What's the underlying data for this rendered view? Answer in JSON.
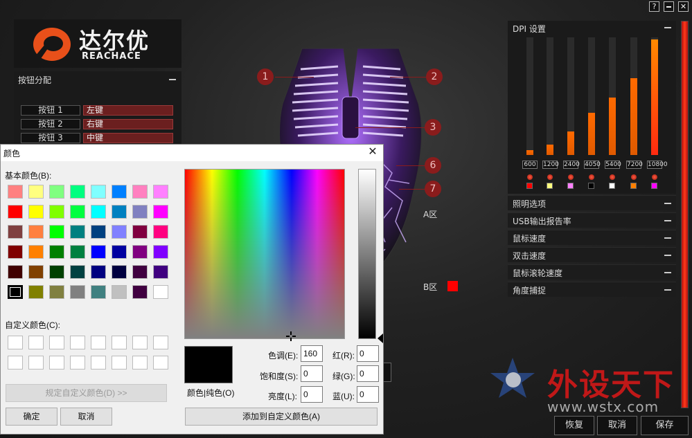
{
  "window": {
    "help_label": "?",
    "minimize_label": "",
    "close_label": "✕"
  },
  "logo": {
    "cn": "达尔优",
    "en": "REACHACE"
  },
  "buttons_panel": {
    "title": "按钮分配",
    "rows": [
      {
        "button": "按钮 1",
        "value": "左键"
      },
      {
        "button": "按钮 2",
        "value": "右键"
      },
      {
        "button": "按钮 3",
        "value": "中键"
      }
    ]
  },
  "mouse": {
    "callouts": [
      "1",
      "2",
      "3",
      "6",
      "7"
    ],
    "zones": [
      {
        "label": "A区"
      },
      {
        "label": "B区",
        "color": "#ff0000"
      }
    ]
  },
  "dpi": {
    "title": "DPI 设置",
    "levels": [
      {
        "value": "600",
        "level": 0.04,
        "color": "#ff0000"
      },
      {
        "value": "1200",
        "level": 0.09,
        "color": "#ffff80"
      },
      {
        "value": "2400",
        "level": 0.2,
        "color": "#ff80ff"
      },
      {
        "value": "4050",
        "level": 0.36,
        "color": "#000000"
      },
      {
        "value": "5400",
        "level": 0.49,
        "color": "#ffffff"
      },
      {
        "value": "7200",
        "level": 0.65,
        "color": "#ff8000"
      },
      {
        "value": "10800",
        "level": 0.98,
        "color": "#ff00ff"
      }
    ]
  },
  "sections": [
    "照明选项",
    "USB输出报告率",
    "鼠标速度",
    "双击速度",
    "鼠标滚轮速度",
    "角度捕捉"
  ],
  "footer": {
    "restore": "恢复",
    "cancel": "取消",
    "save": "保存"
  },
  "watermark": {
    "cn": "外设天下",
    "url": "www.wstx.com"
  },
  "color_dialog": {
    "title": "颜色",
    "basic_colors_label": "基本颜色(B):",
    "custom_colors_label": "自定义颜色(C):",
    "define_custom_button": "规定自定义颜色(D) >>",
    "ok_button": "确定",
    "cancel_button": "取消",
    "add_custom_button": "添加到自定义颜色(A)",
    "preview_label": "颜色|纯色(O)",
    "hue_label": "色调(E):",
    "hue_value": "160",
    "sat_label": "饱和度(S):",
    "sat_value": "0",
    "lum_label": "亮度(L):",
    "lum_value": "0",
    "red_label": "红(R):",
    "red_value": "0",
    "green_label": "绿(G):",
    "green_value": "0",
    "blue_label": "蓝(U):",
    "blue_value": "0",
    "basic_colors": [
      [
        "#ff8080",
        "#ffff80",
        "#80ff80",
        "#00ff80",
        "#80ffff",
        "#0080ff",
        "#ff80c0",
        "#ff80ff"
      ],
      [
        "#ff0000",
        "#ffff00",
        "#80ff00",
        "#00ff40",
        "#00ffff",
        "#0080c0",
        "#8080c0",
        "#ff00ff"
      ],
      [
        "#804040",
        "#ff8040",
        "#00ff00",
        "#008080",
        "#004080",
        "#8080ff",
        "#800040",
        "#ff0080"
      ],
      [
        "#800000",
        "#ff8000",
        "#008000",
        "#008040",
        "#0000ff",
        "#0000a0",
        "#800080",
        "#8000ff"
      ],
      [
        "#400000",
        "#804000",
        "#004000",
        "#004040",
        "#000080",
        "#000040",
        "#400040",
        "#400080"
      ],
      [
        "#000000",
        "#808000",
        "#808040",
        "#808080",
        "#408080",
        "#c0c0c0",
        "#400040",
        "#ffffff"
      ]
    ]
  }
}
